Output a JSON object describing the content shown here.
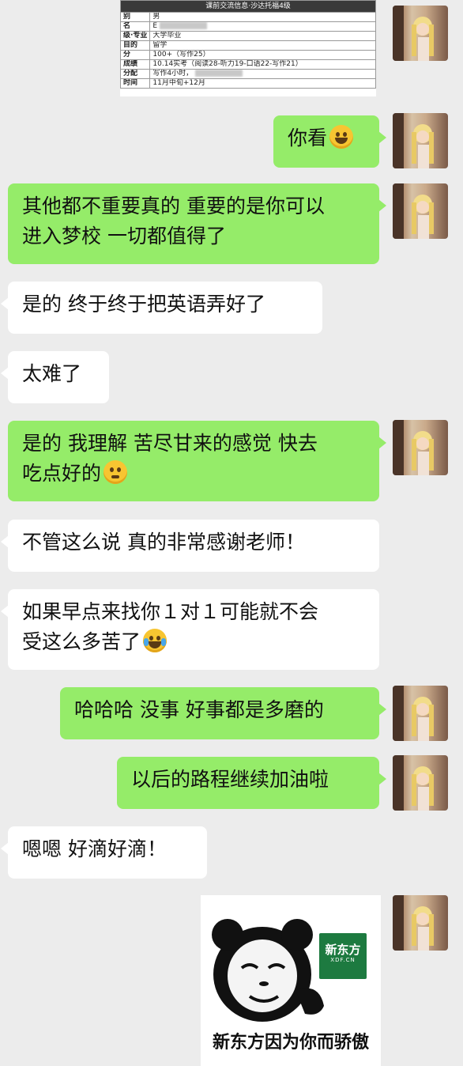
{
  "document_snippet": {
    "header": "课前交流信息·沙达托福4级",
    "rows": [
      {
        "key": "别",
        "value": "男"
      },
      {
        "key": "名",
        "value": "E"
      },
      {
        "key": "级·专业",
        "value": "大学毕业"
      },
      {
        "key": "目的",
        "value": "留学"
      },
      {
        "key": "分",
        "value": "100+（写作25）"
      },
      {
        "key": "成绩",
        "value": "10.14实考（阅读28-听力19-口语22-写作21）"
      },
      {
        "key": "分配",
        "value": "写作4小时，"
      },
      {
        "key": "时间",
        "value": "11月中旬+12月"
      }
    ]
  },
  "messages": [
    {
      "side": "out",
      "text": "你看",
      "emoji": "grin-emoji"
    },
    {
      "side": "out",
      "lines": [
        "其他都不重要真的 重要的是你可以",
        "进入梦校 一切都值得了"
      ]
    },
    {
      "side": "in",
      "text": "是的 终于终于把英语弄好了"
    },
    {
      "side": "in",
      "text": "太难了"
    },
    {
      "side": "out",
      "lines": [
        "是的 我理解 苦尽甘来的感觉 快去",
        "吃点好的"
      ],
      "emoji": "thinking-emoji"
    },
    {
      "side": "in",
      "text": "不管这么说 真的非常感谢老师！"
    },
    {
      "side": "in",
      "lines": [
        "如果早点来找你１对１可能就不会",
        "受这么多苦了"
      ],
      "emoji": "tears-of-joy-emoji"
    },
    {
      "side": "out",
      "text": "哈哈哈 没事 好事都是多磨的"
    },
    {
      "side": "out",
      "text": "以后的路程继续加油啦"
    },
    {
      "side": "in",
      "text": "嗯嗯 好滴好滴！"
    }
  ],
  "sticker": {
    "caption": "新东方因为你而骄傲",
    "logo_text": "新东方",
    "logo_sub": "XDF.CN"
  },
  "colors": {
    "background": "#ececec",
    "outgoing_bubble": "#95ec69",
    "incoming_bubble": "#ffffff",
    "logo_green": "#1d7a40"
  }
}
